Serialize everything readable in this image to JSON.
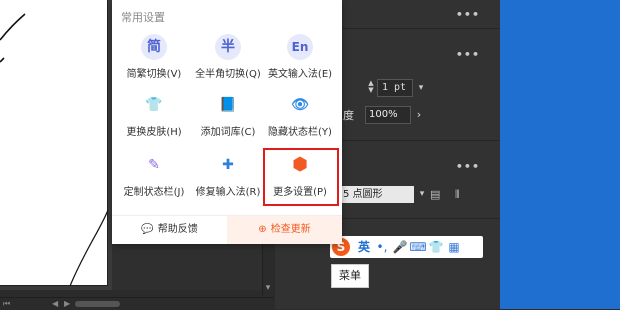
{
  "menu": {
    "section_title": "常用设置",
    "items": [
      {
        "label": "简繁切换(V)",
        "glyph": "简",
        "icon": "simplified-traditional-icon"
      },
      {
        "label": "全半角切换(Q)",
        "glyph": "半",
        "icon": "fullwidth-halfwidth-icon"
      },
      {
        "label": "英文输入法(E)",
        "glyph": "En",
        "icon": "english-input-icon"
      },
      {
        "label": "更换皮肤(H)",
        "glyph": "👕",
        "icon": "skin-shirt-icon"
      },
      {
        "label": "添加词库(C)",
        "glyph": "📘",
        "icon": "dictionary-book-icon"
      },
      {
        "label": "隐藏状态栏(Y)",
        "glyph": "👁",
        "icon": "hide-eye-icon"
      },
      {
        "label": "定制状态栏(J)",
        "glyph": "✎",
        "icon": "customize-pencil-icon"
      },
      {
        "label": "修复输入法(R)",
        "glyph": "✚",
        "icon": "repair-kit-icon"
      },
      {
        "label": "更多设置(P)",
        "glyph": "⬢",
        "icon": "settings-hexagon-icon"
      }
    ],
    "footer": {
      "help_label": "帮助反馈",
      "help_icon": "💬",
      "update_label": "检查更新",
      "update_icon": "⊕"
    }
  },
  "panel": {
    "pt_value": "1 pt",
    "deg_label": "度",
    "percent_value": "100%",
    "dot_select_value": "5 点圆形",
    "dots": "•••"
  },
  "ime_bar": {
    "logo": "S",
    "lang": "英",
    "punct": "•,",
    "mic_icon": "🎤",
    "keyboard_icon": "⌨",
    "shirt_icon": "👕",
    "apps_icon": "▦"
  },
  "tooltip": "菜单",
  "colors": {
    "accent_orange": "#f15a22",
    "highlight_red": "#e21b1b",
    "icon_blue": "#4f63d2",
    "desktop_blue": "#1f6fd0"
  }
}
